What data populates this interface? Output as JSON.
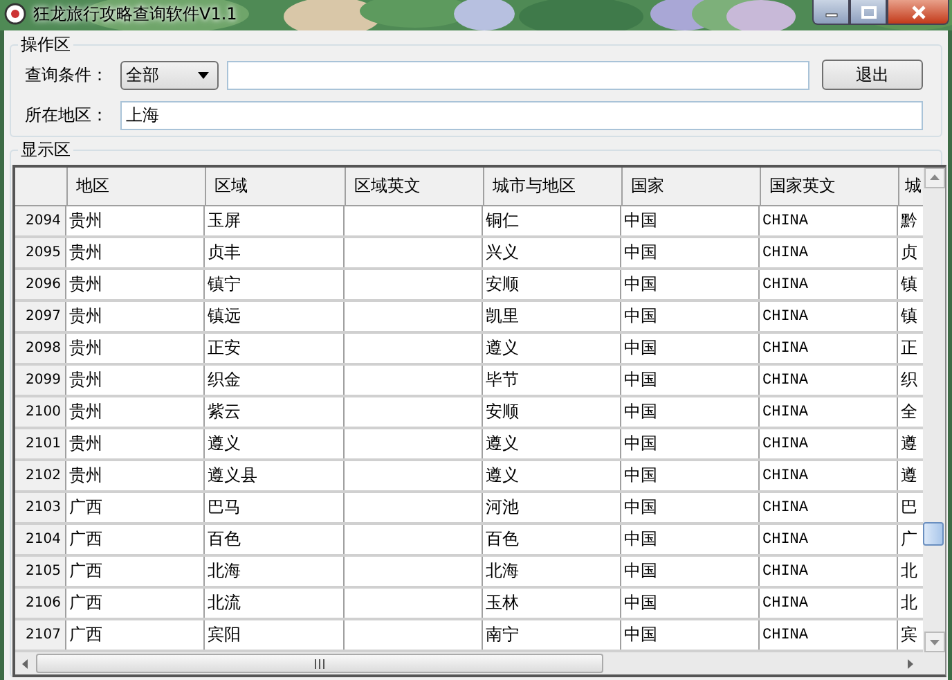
{
  "window": {
    "title": "狂龙旅行攻略查询软件V1.1"
  },
  "operation_group": {
    "title": "操作区",
    "query_label": "查询条件：",
    "query_select": {
      "value": "全部"
    },
    "exit_button": "退出",
    "location_label": "所在地区：",
    "location_field": {
      "value": "上海"
    }
  },
  "display_group": {
    "title": "显示区"
  },
  "table": {
    "columns": [
      "地区",
      "区域",
      "区域英文",
      "城市与地区",
      "国家",
      "国家英文",
      "城"
    ],
    "rows": [
      {
        "number": "2094",
        "cells": [
          "贵州",
          "玉屏",
          "",
          "铜仁",
          "中国",
          "CHINA",
          "黔"
        ]
      },
      {
        "number": "2095",
        "cells": [
          "贵州",
          "贞丰",
          "",
          "兴义",
          "中国",
          "CHINA",
          "贞"
        ]
      },
      {
        "number": "2096",
        "cells": [
          "贵州",
          "镇宁",
          "",
          "安顺",
          "中国",
          "CHINA",
          "镇"
        ]
      },
      {
        "number": "2097",
        "cells": [
          "贵州",
          "镇远",
          "",
          "凯里",
          "中国",
          "CHINA",
          "镇"
        ]
      },
      {
        "number": "2098",
        "cells": [
          "贵州",
          "正安",
          "",
          "遵义",
          "中国",
          "CHINA",
          "正"
        ]
      },
      {
        "number": "2099",
        "cells": [
          "贵州",
          "织金",
          "",
          "毕节",
          "中国",
          "CHINA",
          "织"
        ]
      },
      {
        "number": "2100",
        "cells": [
          "贵州",
          "紫云",
          "",
          "安顺",
          "中国",
          "CHINA",
          "全"
        ]
      },
      {
        "number": "2101",
        "cells": [
          "贵州",
          "遵义",
          "",
          "遵义",
          "中国",
          "CHINA",
          "遵"
        ]
      },
      {
        "number": "2102",
        "cells": [
          "贵州",
          "遵义县",
          "",
          "遵义",
          "中国",
          "CHINA",
          "遵"
        ]
      },
      {
        "number": "2103",
        "cells": [
          "广西",
          "巴马",
          "",
          "河池",
          "中国",
          "CHINA",
          "巴"
        ]
      },
      {
        "number": "2104",
        "cells": [
          "广西",
          "百色",
          "",
          "百色",
          "中国",
          "CHINA",
          "广"
        ]
      },
      {
        "number": "2105",
        "cells": [
          "广西",
          "北海",
          "",
          "北海",
          "中国",
          "CHINA",
          "北"
        ]
      },
      {
        "number": "2106",
        "cells": [
          "广西",
          "北流",
          "",
          "玉林",
          "中国",
          "CHINA",
          "北"
        ]
      },
      {
        "number": "2107",
        "cells": [
          "广西",
          "宾阳",
          "",
          "南宁",
          "中国",
          "CHINA",
          "宾"
        ]
      }
    ]
  }
}
